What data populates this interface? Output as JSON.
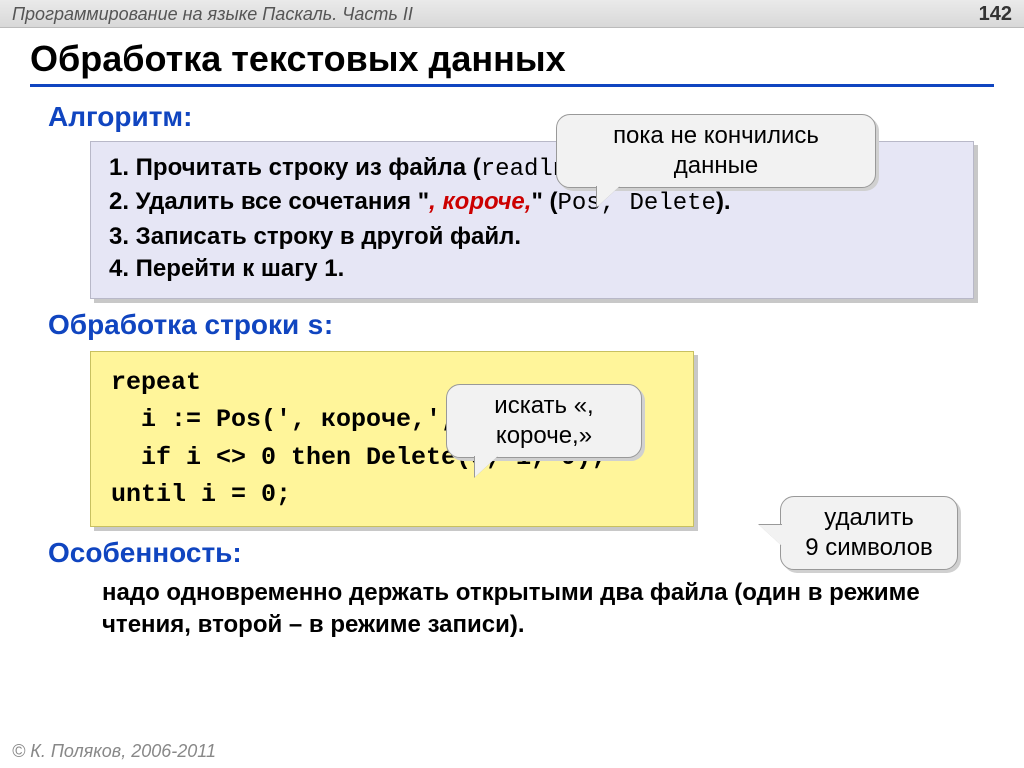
{
  "topbar": {
    "title": "Программирование на языке Паскаль. Часть II",
    "page": "142"
  },
  "title": "Обработка текстовых данных",
  "sections": {
    "algo": "Алгоритм:",
    "proc_pre": "Обработка строки ",
    "proc_s": "s",
    "proc_post": ":",
    "feature": "Особенность:"
  },
  "algo": {
    "l1_a": "1. Прочитать строку из файла (",
    "l1_mono": "readln",
    "l1_b": ").",
    "l2_a": "2. Удалить все сочетания \"",
    "l2_em": ", короче,",
    "l2_b": "\" (",
    "l2_mono": "Pos, Delete",
    "l2_c": ").",
    "l3": "3. Записать строку в другой файл.",
    "l4": "4. Перейти к шагу 1."
  },
  "code": {
    "l1": "repeat",
    "l2": "  i := Pos(', короче,', s);",
    "l3": "  if i <> 0 then Delete(s, i, 9);",
    "l4": "until i = 0;"
  },
  "callouts": {
    "c1": "пока не кончились данные",
    "c2": "искать «, короче,»",
    "c3": "удалить 9 символов"
  },
  "feature_text": "надо одновременно держать открытыми два файла (один в режиме чтения, второй – в режиме записи).",
  "footer": "© К. Поляков, 2006-2011"
}
